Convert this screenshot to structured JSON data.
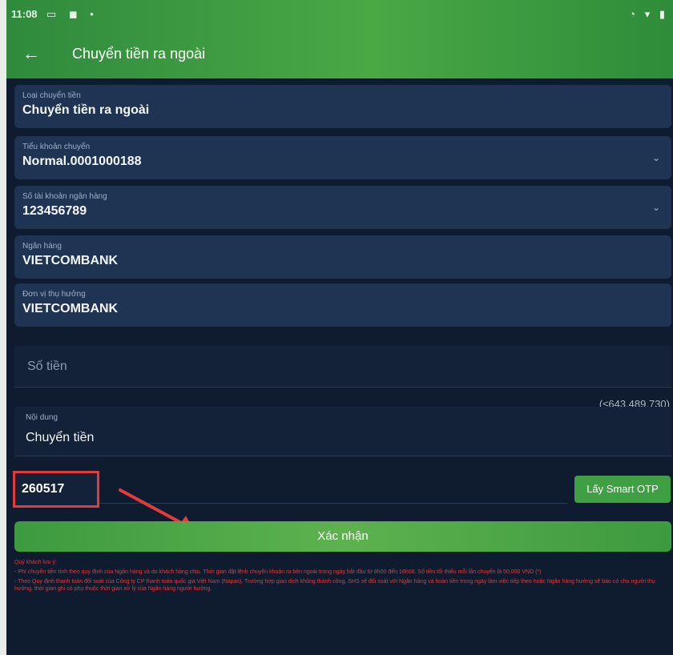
{
  "status_bar": {
    "time": "11:08",
    "left_icons": "▭ ◼ •",
    "right_icons": "◔ ▾ ▮"
  },
  "header": {
    "title": "Chuyển tiền ra ngoài",
    "back_icon": "arrow-left-icon"
  },
  "form": {
    "transfer_type": {
      "label": "Loại chuyển tiền",
      "value": "Chuyển tiền ra ngoài"
    },
    "sub_account": {
      "label": "Tiểu khoản chuyển",
      "value": "Normal.0001000188"
    },
    "bank_account": {
      "label": "Số tài khoản ngân hàng",
      "value": "123456789"
    },
    "bank": {
      "label": "Ngân hàng",
      "value": "VIETCOMBANK"
    },
    "beneficiary": {
      "label": "Đơn vị thụ hưởng",
      "value": "VIETCOMBANK"
    },
    "amount": {
      "placeholder": "Số tiền",
      "balance_hint": "(≤643,489,730)"
    },
    "content": {
      "label": "Nội dung",
      "value": "Chuyển tiền"
    },
    "otp": {
      "value": "260517",
      "button_label": "Lấy Smart OTP"
    }
  },
  "confirm_label": "Xác nhận",
  "notes": {
    "title": "Quý khách lưu ý:",
    "line1": "- Phí chuyển tiền tính theo quy định của Ngân hàng và do khách hàng chịu. Thời gian đặt lệnh chuyển khoản ra bên ngoài trong ngày bắt đầu từ 8h00 đến 16h00. Số tiền tối thiểu mỗi lần chuyển là 50,000 VND (*)",
    "line2": "- Theo Quy định thanh toán đối soát của Công ty CP thanh toán quốc gia Việt Nam (Napas), Trường hợp giao dịch không thành công, SHS sẽ đối soát với Ngân hàng và hoàn tiền trong ngày làm việc tiếp theo hoặc Ngân hàng hưởng sẽ báo có cho người thụ hưởng, thời gian ghi có phụ thuộc thời gian xử lý của Ngân hàng người hưởng."
  },
  "colors": {
    "background": "#0f1c2f",
    "field": "#1f3352",
    "accent_green": "#3fa043",
    "highlight_red": "#e23b3b"
  }
}
